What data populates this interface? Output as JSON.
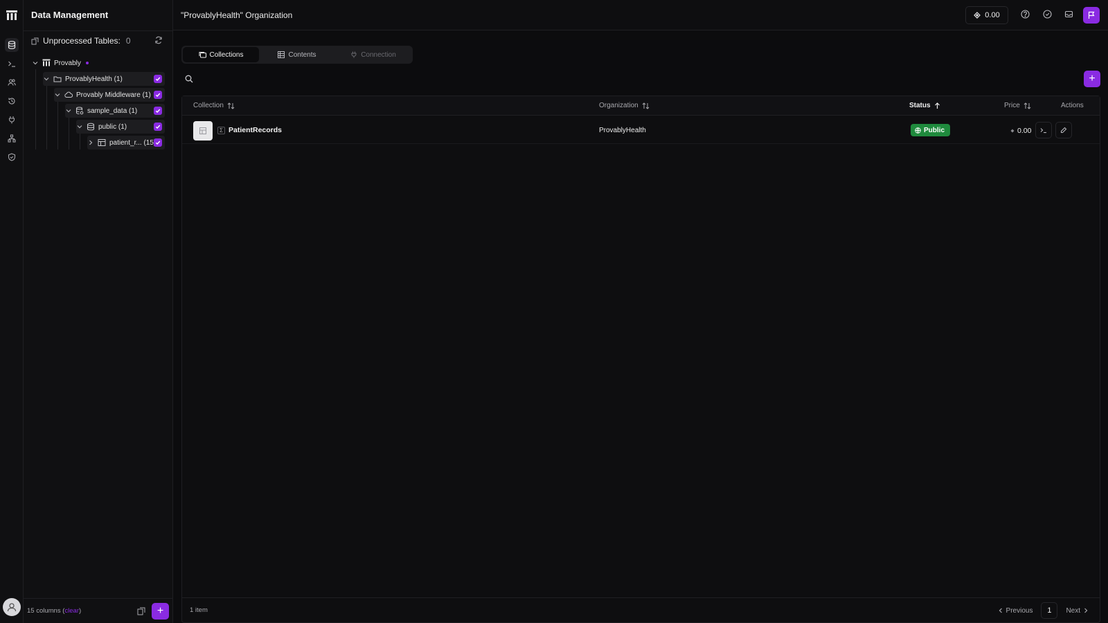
{
  "sidebar": {
    "title": "Data Management",
    "unprocessed_label": "Unprocessed Tables:",
    "unprocessed_count": "0",
    "tree": [
      {
        "label": "Provably",
        "icon": "org-logo-icon"
      },
      {
        "label": "ProvablyHealth (1)",
        "icon": "folder-icon",
        "checked": true
      },
      {
        "label": "Provably Middleware (1)",
        "icon": "cloud-icon",
        "checked": true
      },
      {
        "label": "sample_data (1)",
        "icon": "database-icon",
        "checked": true
      },
      {
        "label": "public (1)",
        "icon": "schema-icon",
        "checked": true
      },
      {
        "label": "patient_r... (15)",
        "icon": "table-icon",
        "checked": true
      }
    ],
    "footer": {
      "columns_text": "15 columns (",
      "clear_label": "clear",
      "close_paren": ")",
      "add_label": "+"
    }
  },
  "header": {
    "org_title": "\"ProvablyHealth\" Organization",
    "balance": "0.00"
  },
  "tabs": [
    {
      "label": "Collections",
      "icon": "collections-icon",
      "active": true
    },
    {
      "label": "Contents",
      "icon": "grid-icon",
      "active": false
    },
    {
      "label": "Connection",
      "icon": "plug-icon",
      "active": false,
      "disabled": true
    }
  ],
  "add_label": "+",
  "table": {
    "columns": [
      "Collection",
      "Organization",
      "Status",
      "Price",
      "Actions"
    ],
    "rows": [
      {
        "collection": "PatientRecords",
        "organization": "ProvablyHealth",
        "status": "Public",
        "price": "0.00"
      }
    ]
  },
  "footer": {
    "items": "1 item",
    "previous": "Previous",
    "page": "1",
    "next": "Next"
  },
  "colors": {
    "accent": "#8a2be2",
    "public_badge": "#1f8a3d",
    "background": "#0c0c0e"
  }
}
